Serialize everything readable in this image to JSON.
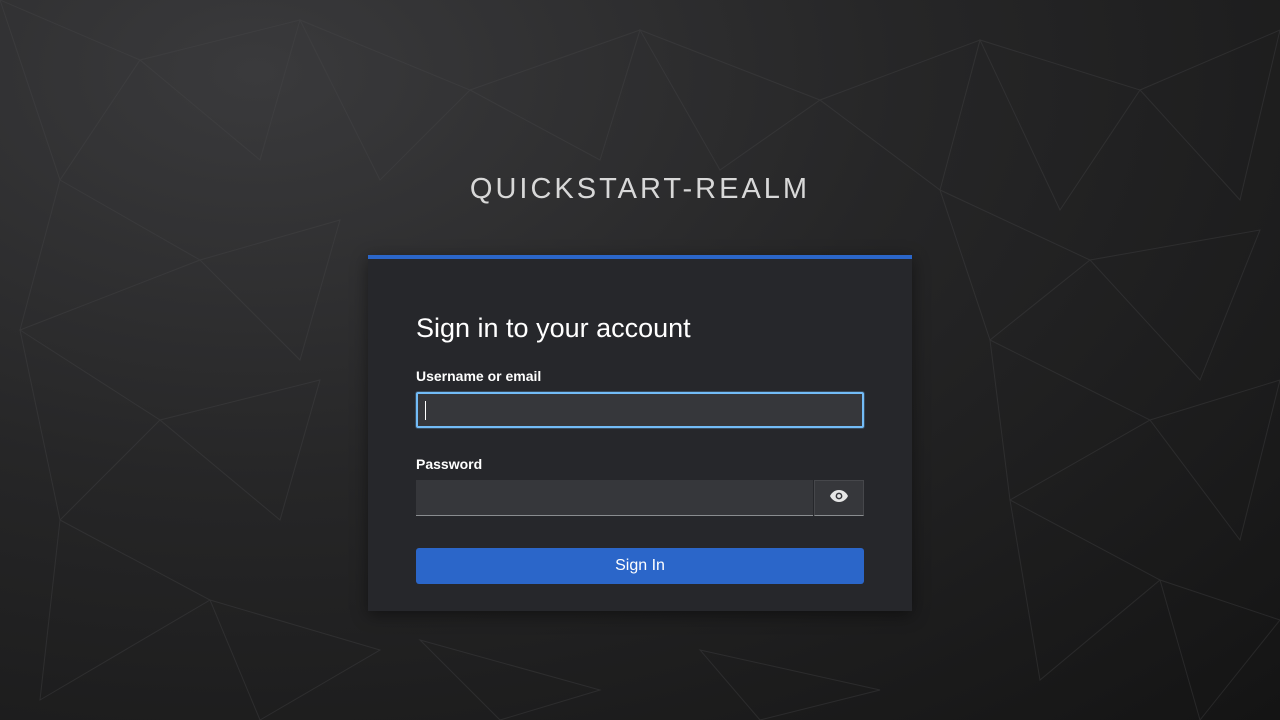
{
  "realm": {
    "title": "QUICKSTART-REALM"
  },
  "login": {
    "heading": "Sign in to your account",
    "username": {
      "label": "Username or email",
      "value": "",
      "placeholder": ""
    },
    "password": {
      "label": "Password",
      "value": "",
      "placeholder": "",
      "toggle_icon": "eye-icon"
    },
    "submit_label": "Sign In"
  },
  "colors": {
    "accent": "#2b66c9",
    "focus_border": "#73bcf7",
    "card_background": "#26272b",
    "input_background": "#36373b"
  }
}
